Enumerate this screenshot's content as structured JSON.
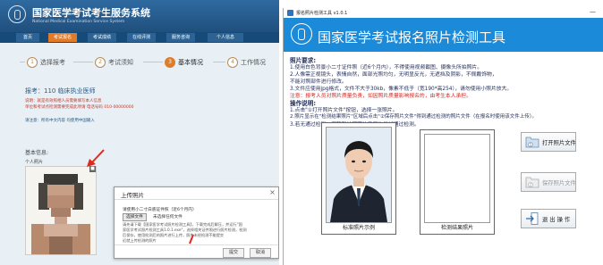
{
  "left_site": {
    "title": "国家医学考试考生服务系统",
    "subtitle": "National Medical Examination Service System",
    "nav": [
      {
        "label": "首页",
        "active": false
      },
      {
        "label": "考试报名",
        "active": true
      },
      {
        "label": "考试成绩",
        "active": false
      },
      {
        "label": "在线评测",
        "active": false
      },
      {
        "label": "服务咨询",
        "active": false
      },
      {
        "label": "个人信息",
        "active": false
      }
    ],
    "steps": [
      {
        "num": "1",
        "label": "选择报考",
        "active": false
      },
      {
        "num": "2",
        "label": "考试须知",
        "active": false
      },
      {
        "num": "3",
        "label": "基本情况",
        "active": true
      },
      {
        "num": "4",
        "label": "工作情况",
        "active": false
      }
    ],
    "exam_line": "报考：110 临床执业医师",
    "red_notice": [
      "说明：就是有效照相人员需要填写本人信息",
      "单位和考试点检测需要完成此项请 电话号码 010-00000000"
    ],
    "remark": "请注意：所有中文内容 均使用中国输入",
    "basic_info": "基本信息:",
    "person_photo": "个人照片",
    "dialog": {
      "title": "上传照片",
      "close": "×",
      "hint": "请使用小二寸白底证件照（近6个月内）",
      "choose_button": "选择文件",
      "no_file": "未选择任何文件",
      "notes": [
        "请先请下载【国家医学考试照片检测工具】，下载完成后解压，并运行\"国",
        "家医学考试照片检测工具1.0.1.exe\"，选择相关证件照进行照片检测，检测",
        "后保存，使用检测后的照片进行上传，照片未经检测不能提交",
        "近就上传检测的照片"
      ],
      "submit": "提交",
      "cancel": "取消"
    }
  },
  "right_app": {
    "window_title": "报名照片检测工具 v1.0.1",
    "minimize": "—",
    "banner_title": "国家医学考试报名照片检测工具",
    "requirements_head": "照片要求:",
    "requirements": [
      "1.使用白色背景小二寸证件照（近6个月内），不得使用视频截图、摄像头所拍照片。",
      "2.人像需正视镜头，表情自然，面部光照均匀，无明显反光，无遮挡及阴影，不佩戴饰物，",
      "不能对照部件进行修改。",
      "3.文件应使用jpg格式，文件不大于30kb，像素不低于（宽190*高254），请勿使用小照片放大。"
    ],
    "warning": "注意：报考人员对照片质量负责，如因照片质量影响报名的，由考生本人承担。",
    "operations_head": "操作说明:",
    "operations": [
      "1.点击\"①打开照片文件\"按钮，选择一张照片。",
      "2.照片显示在\"检测结果照片\"区域后点击\"②保存照片文件\"得到通过检测的照片文件（在报名时使用该文件上传）。",
      "3.若无通过检测，调整新处理照片后再次尝试通过检测。"
    ],
    "standard_caption": "标准照片示例",
    "result_caption": "检测结果照片",
    "buttons": {
      "open": "打开照片文件",
      "save": "保存照片文件",
      "exit": "退 出 操 作"
    },
    "colors": {
      "banner": "#1b8ad8",
      "warning": "#d4241c",
      "active_nav": "#e07b2a"
    }
  }
}
